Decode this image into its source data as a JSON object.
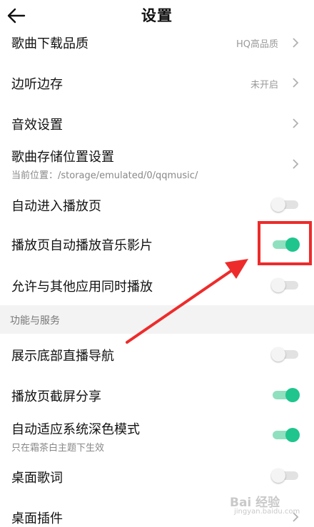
{
  "header": {
    "title": "设置",
    "back_icon": "arrow-left-icon"
  },
  "rows": [
    {
      "label": "歌曲下载品质",
      "value": "HQ高品质",
      "control": "chevron"
    },
    {
      "label": "边听边存",
      "value": "未开启",
      "control": "chevron"
    },
    {
      "label": "音效设置",
      "control": "chevron"
    },
    {
      "label": "歌曲存储位置设置",
      "sublabel": "当前位置：/storage/emulated/0/qqmusic/",
      "control": "chevron"
    },
    {
      "label": "自动进入播放页",
      "control": "toggle",
      "on": false
    },
    {
      "label": "播放页自动播放音乐影片",
      "control": "toggle",
      "on": true
    },
    {
      "label": "允许与其他应用同时播放",
      "control": "toggle",
      "on": false
    }
  ],
  "section": {
    "label": "功能与服务"
  },
  "rows2": [
    {
      "label": "展示底部直播导航",
      "control": "toggle",
      "on": false
    },
    {
      "label": "播放页截屏分享",
      "control": "toggle",
      "on": true
    },
    {
      "label": "自动适应系统深色模式",
      "sublabel": "只在霜茶白主题下生效",
      "control": "toggle",
      "on": true
    },
    {
      "label": "桌面歌词",
      "control": "toggle",
      "on": false
    },
    {
      "label": "桌面插件",
      "control": "chevron"
    }
  ],
  "colors": {
    "accent": "#1fc58c",
    "accent_track": "#8fe0bf",
    "annotation": "#ee2b2b"
  },
  "watermark": {
    "text": "Bai 经验",
    "sub": "jingyan.baidu.com"
  }
}
